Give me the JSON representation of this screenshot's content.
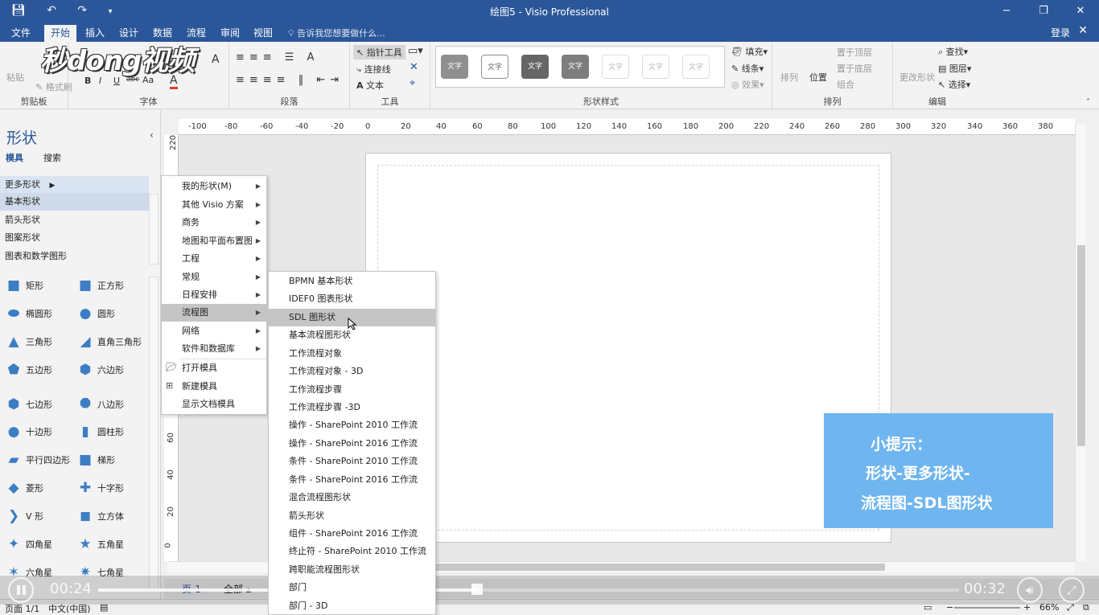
{
  "window": {
    "title": "绘图5 - Visio Professional",
    "minimize": "−",
    "restore": "❐",
    "close": "✕"
  },
  "ribbon_tabs": [
    "文件",
    "开始",
    "插入",
    "设计",
    "数据",
    "流程",
    "审阅",
    "视图"
  ],
  "tell_me": "告诉我您想要做什么...",
  "login": "登录",
  "ribbon": {
    "clipboard": {
      "paste": "粘贴",
      "format_painter": "格式刷",
      "label": "剪贴板"
    },
    "font": {
      "label": "字体",
      "bold": "B",
      "italic": "I",
      "underline": "U",
      "strike": "abc",
      "case": "Aa",
      "color": "A"
    },
    "paragraph": {
      "label": "段落"
    },
    "tools": {
      "pointer": "指针工具",
      "connector": "连接线",
      "text": "文本",
      "label": "工具"
    },
    "shape_styles": {
      "sample": "文字",
      "label": "形状样式",
      "fill": "填充",
      "line": "线条",
      "effects": "效果"
    },
    "arrange": {
      "align": "排列",
      "position": "位置",
      "bring_front": "置于顶层",
      "send_back": "置于底层",
      "group": "组合",
      "label": "排列"
    },
    "editing": {
      "change_shape": "更改形状",
      "find": "查找",
      "layers": "图层",
      "select": "选择",
      "label": "编辑"
    }
  },
  "logo_text": "秒dong视频",
  "shapes_panel": {
    "title": "形状",
    "tab_stencils": "模具",
    "tab_search": "搜索",
    "stencils": [
      "更多形状",
      "基本形状",
      "箭头形状",
      "图案形状",
      "图表和数学图形"
    ],
    "shapes": [
      [
        "矩形",
        "正方形"
      ],
      [
        "椭圆形",
        "圆形"
      ],
      [
        "三角形",
        "直角三角形"
      ],
      [
        "五边形",
        "六边形"
      ],
      [
        "七边形",
        "八边形"
      ],
      [
        "十边形",
        "圆柱形"
      ],
      [
        "平行四边形",
        "梯形"
      ],
      [
        "菱形",
        "十字形"
      ],
      [
        "V 形",
        "立方体"
      ],
      [
        "四角星",
        "五角星"
      ],
      [
        "六角星",
        "七角星"
      ]
    ]
  },
  "ruler_h": [
    "-100",
    "-80",
    "-60",
    "-40",
    "-20",
    "0",
    "20",
    "40",
    "60",
    "80",
    "100",
    "120",
    "140",
    "160",
    "180",
    "200",
    "220",
    "240",
    "260",
    "280",
    "300",
    "320",
    "340",
    "360",
    "380"
  ],
  "ruler_v": [
    "220",
    "60",
    "40",
    "20",
    "0"
  ],
  "more_shapes_menu": [
    {
      "label": "我的形状(M)",
      "submenu": true
    },
    {
      "label": "其他 Visio 方案",
      "submenu": true
    },
    {
      "label": "商务",
      "submenu": true
    },
    {
      "label": "地图和平面布置图",
      "submenu": true
    },
    {
      "label": "工程",
      "submenu": true
    },
    {
      "label": "常规",
      "submenu": true
    },
    {
      "label": "日程安排",
      "submenu": true
    },
    {
      "label": "流程图",
      "submenu": true,
      "selected": true
    },
    {
      "label": "网络",
      "submenu": true
    },
    {
      "label": "软件和数据库",
      "submenu": true
    },
    {
      "label": "打开模具",
      "submenu": false
    },
    {
      "label": "新建模具",
      "submenu": false
    },
    {
      "label": "显示文档模具",
      "submenu": false
    }
  ],
  "flowchart_menu": [
    "BPMN 基本形状",
    "IDEF0 图表形状",
    "SDL 图形状",
    "基本流程图形状",
    "工作流程对象",
    "工作流程对象 - 3D",
    "工作流程步骤",
    "工作流程步骤 -3D",
    "操作 - SharePoint 2010 工作流",
    "操作 - SharePoint 2016 工作流",
    "条件 - SharePoint 2010 工作流",
    "条件 - SharePoint 2016 工作流",
    "混合流程图形状",
    "箭头形状",
    "组件 - SharePoint 2016 工作流",
    "终止符 - SharePoint 2010 工作流",
    "跨职能流程图形状",
    "部门",
    "部门 - 3D"
  ],
  "flowchart_selected_index": 2,
  "tip": {
    "line1": "小提示：",
    "line2": "形状-更多形状-",
    "line3": "流程图-SDL图形状"
  },
  "page_tabs": {
    "page": "页-1",
    "all": "全部 ▴"
  },
  "video": {
    "elapsed": "00:24",
    "total": "00:32",
    "progress": 0.44
  },
  "status": {
    "page": "页面 1/1",
    "language": "中文(中国)",
    "zoom": "66%"
  }
}
